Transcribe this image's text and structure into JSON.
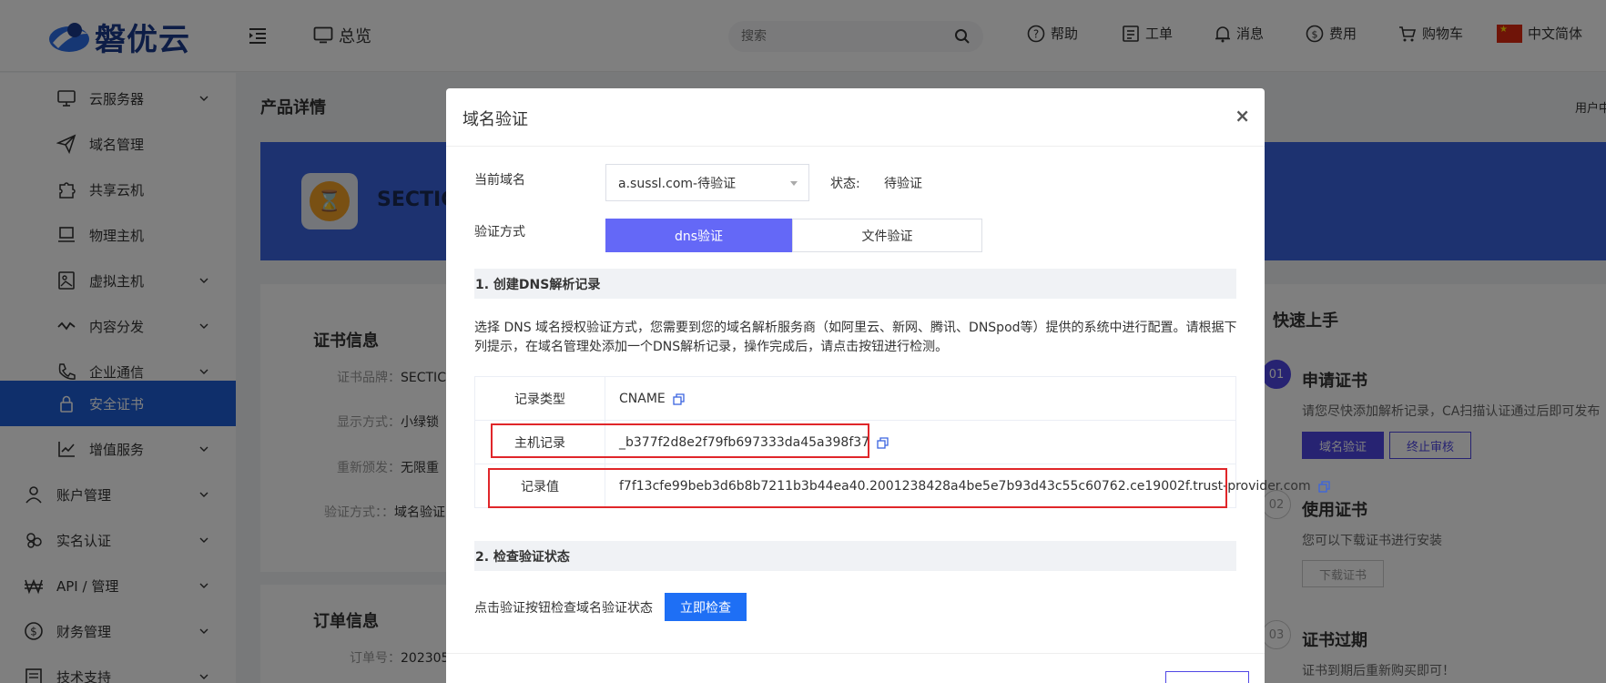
{
  "header": {
    "logo_text": "磐优云",
    "overview": "总览",
    "search_placeholder": "搜索",
    "nav": [
      {
        "label": "帮助",
        "icon": "help-icon"
      },
      {
        "label": "工单",
        "icon": "ticket-icon"
      },
      {
        "label": "消息",
        "icon": "bell-icon"
      },
      {
        "label": "费用",
        "icon": "fee-icon"
      },
      {
        "label": "购物车",
        "icon": "cart-icon"
      },
      {
        "label": "中文简体",
        "icon": "china-flag-icon"
      }
    ]
  },
  "sidebar": {
    "items": [
      {
        "label": "云服务器",
        "icon": "monitor-icon",
        "chevron": true
      },
      {
        "label": "域名管理",
        "icon": "send-icon",
        "chevron": false
      },
      {
        "label": "共享云机",
        "icon": "puzzle-icon",
        "chevron": false
      },
      {
        "label": "物理主机",
        "icon": "laptop-icon",
        "chevron": false
      },
      {
        "label": "虚拟主机",
        "icon": "image-icon",
        "chevron": true
      },
      {
        "label": "内容分发",
        "icon": "pulse-icon",
        "chevron": true
      },
      {
        "label": "企业通信",
        "icon": "phone-icon",
        "chevron": true
      },
      {
        "label": "安全证书",
        "icon": "lock-icon",
        "chevron": false,
        "active": true
      },
      {
        "label": "增值服务",
        "icon": "chart-icon",
        "chevron": true
      },
      {
        "label": "账户管理",
        "icon": "user-icon",
        "chevron": true
      },
      {
        "label": "实名认证",
        "icon": "group-icon",
        "chevron": true
      },
      {
        "label": "API / 管理",
        "icon": "won-icon",
        "chevron": true
      },
      {
        "label": "财务管理",
        "icon": "dollar-icon",
        "chevron": true
      },
      {
        "label": "技术支持",
        "icon": "doc-icon",
        "chevron": true
      }
    ]
  },
  "main": {
    "title": "产品详情",
    "user_link": "用户中",
    "product_name": "SECTIC",
    "cert_info_title": "证书信息",
    "cert_rows": [
      {
        "label": "证书品牌：",
        "value": "SECTIC"
      },
      {
        "label": "显示方式：",
        "value": "小绿锁"
      },
      {
        "label": "重新颁发：",
        "value": "无限重"
      },
      {
        "label": "验证方式：：",
        "value": "域名验证"
      }
    ],
    "order_info_title": "订单信息",
    "order_no_label": "订单号：",
    "order_no_value": "202305"
  },
  "quickstart": {
    "title": "快速上手",
    "steps": [
      {
        "num": "01",
        "title": "申请证书",
        "desc": "请您尽快添加解析记录，CA扫描认证通过后即可发布",
        "buttons": [
          "域名验证",
          "终止审核"
        ]
      },
      {
        "num": "02",
        "title": "使用证书",
        "desc": "您可以下载证书进行安装",
        "buttons": [
          "下载证书"
        ]
      },
      {
        "num": "03",
        "title": "证书过期",
        "desc": "证书到期后重新购买即可！",
        "buttons": []
      }
    ]
  },
  "modal": {
    "title": "域名验证",
    "close": "×",
    "domain_label": "当前域名",
    "domain_value": "a.sussl.com-待验证",
    "status_label": "状态:",
    "status_value": "待验证",
    "method_label": "验证方式",
    "method_dns": "dns验证",
    "method_file": "文件验证",
    "section1": "1. 创建DNS解析记录",
    "desc": "选择 DNS 域名授权验证方式，您需要到您的域名解析服务商（如阿里云、新网、腾讯、DNSpod等）提供的系统中进行配置。请根据下列提示，在域名管理处添加一个DNS解析记录，操作完成后，请点击按钮进行检测。",
    "records": [
      {
        "key": "记录类型",
        "value": "CNAME"
      },
      {
        "key": "主机记录",
        "value": "_b377f2d8e2f79fb697333da45a398f37"
      },
      {
        "key": "记录值",
        "value": "f7f13cfe99beb3d6b8b7211b3b44ea40.2001238428a4be5e7b93d43c55c60762.ce19002f.trust-provider.com"
      }
    ],
    "section2": "2. 检查验证状态",
    "check_text": "点击验证按钮检查域名验证状态",
    "check_button": "立即检查"
  },
  "colors": {
    "active_sidebar": "#1e5fd6",
    "dns_tab": "#6468f7",
    "check_button": "#1e6ff5",
    "highlight": "#e0262a",
    "step_active": "#4f46e5"
  }
}
